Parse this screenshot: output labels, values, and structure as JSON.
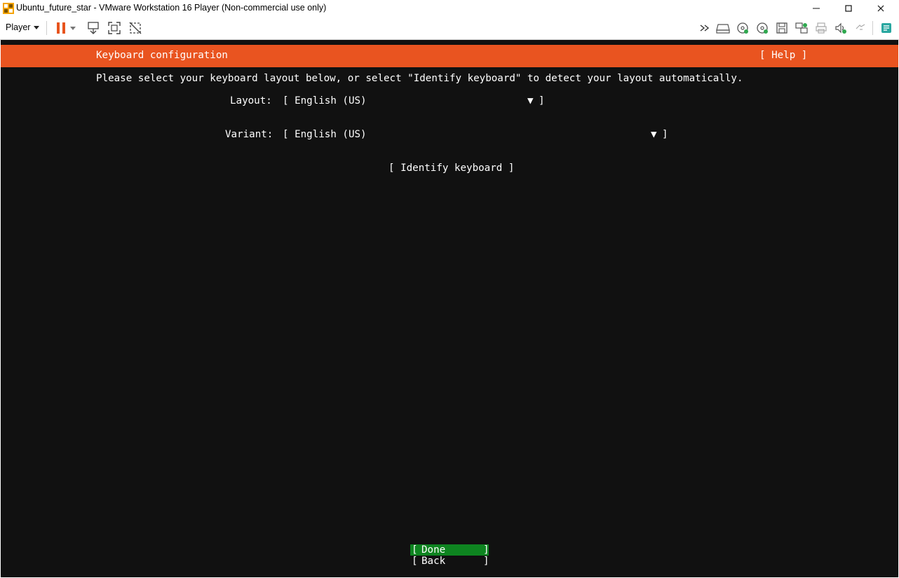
{
  "window": {
    "title": "Ubuntu_future_star - VMware Workstation 16 Player (Non-commercial use only)",
    "controls": {
      "minimize": "—",
      "maximize": "☐",
      "close": "✕"
    }
  },
  "toolbar": {
    "player_label": "Player",
    "icons": [
      "pause-icon",
      "send-ctrl-alt-del-icon",
      "full-screen-icon",
      "unity-icon",
      "more-icon",
      "hard-disk-icon",
      "cd-dvd-icon",
      "cd-dvd-2-icon",
      "floppy-icon",
      "network-adapter-icon",
      "printer-icon",
      "sound-icon",
      "usb-icon",
      "message-log-icon"
    ],
    "accent": "#e8541d"
  },
  "installer": {
    "header_title": "Keyboard configuration",
    "help_label": "[ Help ]",
    "instructions": "Please select your keyboard layout below, or select \"Identify keyboard\" to detect your layout automatically.",
    "layout": {
      "label": "Layout:",
      "value": "[ English (US)",
      "arrow": "▼",
      "close": "]"
    },
    "variant": {
      "label": "Variant:",
      "value": "[ English (US)",
      "arrow": "▼",
      "close": "]"
    },
    "identify_label": "[ Identify keyboard ]",
    "done": {
      "open": "[",
      "label": "Done",
      "close": "]"
    },
    "back": {
      "open": "[",
      "label": "Back",
      "close": "]"
    },
    "colors": {
      "header": "#e95420",
      "background": "#111111",
      "done": "#0e8420"
    }
  }
}
